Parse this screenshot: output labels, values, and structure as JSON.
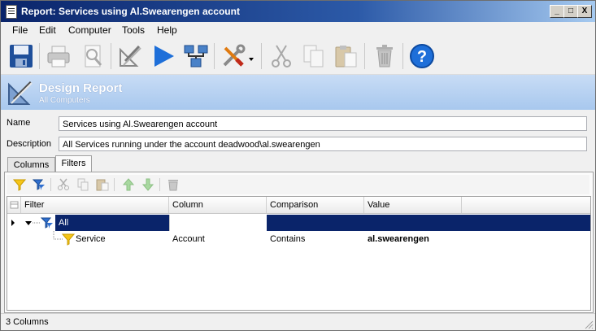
{
  "window": {
    "title": "Report: Services using Al.Swearengen account"
  },
  "window_controls": {
    "minimize": "_",
    "maximize": "□",
    "close": "X"
  },
  "menu": [
    {
      "label": "File"
    },
    {
      "label": "Edit"
    },
    {
      "label": "Computer"
    },
    {
      "label": "Tools"
    },
    {
      "label": "Help"
    }
  ],
  "toolbar": {
    "icons": [
      "save-icon",
      "print-icon",
      "print-preview-icon",
      "design-icon",
      "run-icon",
      "network-icon",
      "tools-icon",
      "cut-icon",
      "copy-icon",
      "paste-icon",
      "delete-icon",
      "help-icon"
    ],
    "help_glyph": "?"
  },
  "banner": {
    "title": "Design Report",
    "subtitle": "All Computers"
  },
  "form": {
    "name_label": "Name",
    "name_value": "Services using Al.Swearengen account",
    "description_label": "Description",
    "description_value": "All Services running under the account deadwood\\al.swearengen"
  },
  "tabs": [
    {
      "label": "Columns",
      "active": false
    },
    {
      "label": "Filters",
      "active": true
    }
  ],
  "filter_grid": {
    "columns": [
      "Filter",
      "Column",
      "Comparison",
      "Value"
    ],
    "rows": [
      {
        "filter": "All",
        "column": "",
        "comparison": "",
        "value": "",
        "selected": true
      },
      {
        "filter": "Service",
        "column": "Account",
        "comparison": "Contains",
        "value": "al.swearengen",
        "selected": false
      }
    ]
  },
  "status": {
    "text": "3 Columns"
  },
  "colors": {
    "selection": "#0a246a",
    "banner": "#b4d0f2",
    "title_start": "#0a246a"
  }
}
